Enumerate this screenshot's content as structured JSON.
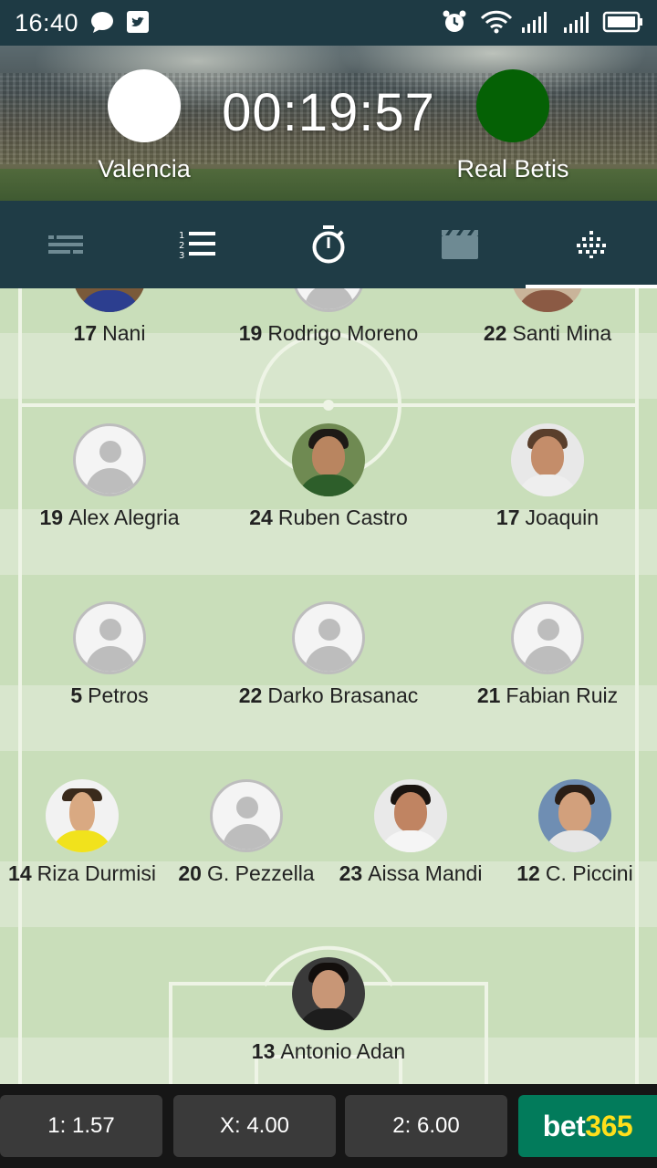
{
  "status_bar": {
    "time": "16:40"
  },
  "match": {
    "home": {
      "name": "Valencia",
      "color": "#ffffff"
    },
    "away": {
      "name": "Real Betis",
      "color": "#056105"
    },
    "clock": "00:19:57"
  },
  "tabs": [
    {
      "icon": "commentary-icon",
      "active": false
    },
    {
      "icon": "numbered-list-icon",
      "active": false
    },
    {
      "icon": "stopwatch-icon",
      "active": false
    },
    {
      "icon": "video-icon",
      "active": false
    },
    {
      "icon": "lineup-formation-icon",
      "active": true
    }
  ],
  "players": [
    {
      "number": "17",
      "name": "Nani"
    },
    {
      "number": "19",
      "name": "Rodrigo Moreno"
    },
    {
      "number": "22",
      "name": "Santi Mina"
    },
    {
      "number": "19",
      "name": "Alex Alegria"
    },
    {
      "number": "24",
      "name": "Ruben Castro"
    },
    {
      "number": "17",
      "name": "Joaquin"
    },
    {
      "number": "5",
      "name": "Petros"
    },
    {
      "number": "22",
      "name": "Darko Brasanac"
    },
    {
      "number": "21",
      "name": "Fabian Ruiz"
    },
    {
      "number": "14",
      "name": "Riza Durmisi"
    },
    {
      "number": "20",
      "name": "G. Pezzella"
    },
    {
      "number": "23",
      "name": "Aissa Mandi"
    },
    {
      "number": "12",
      "name": "C. Piccini"
    },
    {
      "number": "13",
      "name": "Antonio Adan"
    }
  ],
  "odds": {
    "home": "1: 1.57",
    "draw": "X: 4.00",
    "away": "2: 6.00"
  },
  "sponsor": {
    "part1": "bet",
    "part2": "365"
  }
}
